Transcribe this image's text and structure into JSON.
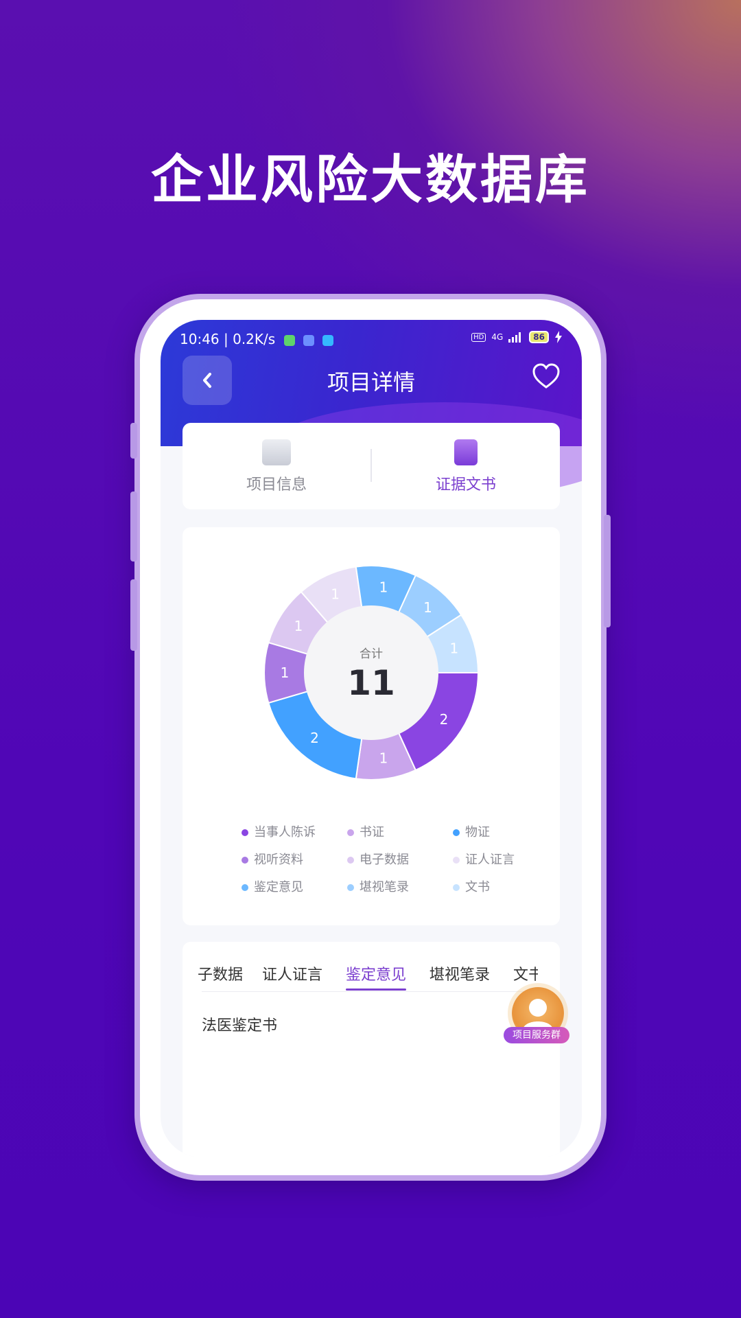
{
  "headline": "企业风险大数据库",
  "status_bar": {
    "time_speed": "10:46 | 0.2K/s",
    "hd": "HD",
    "network": "4G",
    "battery": "86"
  },
  "header": {
    "title": "项目详情",
    "back_icon": "chevron-left-icon",
    "favorite_icon": "heart-outline-icon"
  },
  "top_tabs": [
    {
      "label": "项目信息",
      "icon": "folder-icon",
      "active": false
    },
    {
      "label": "证据文书",
      "icon": "document-icon",
      "active": true
    }
  ],
  "chart_data": {
    "type": "pie",
    "title": "",
    "center_label": "合计",
    "total": "11",
    "slices": [
      {
        "name": "当事人陈诉",
        "value": 2,
        "color": "#8a45e2"
      },
      {
        "name": "书证",
        "value": 1,
        "color": "#c9a5ec"
      },
      {
        "name": "物证",
        "value": 2,
        "color": "#42a1ff"
      },
      {
        "name": "视听资料",
        "value": 1,
        "color": "#a87ae3"
      },
      {
        "name": "电子数据",
        "value": 1,
        "color": "#dcc8f1"
      },
      {
        "name": "证人证言",
        "value": 1,
        "color": "#e9e0f6"
      },
      {
        "name": "鉴定意见",
        "value": 1,
        "color": "#6cb8ff"
      },
      {
        "name": "堪视笔录",
        "value": 1,
        "color": "#9cceff"
      },
      {
        "name": "文书",
        "value": 1,
        "color": "#c7e3ff"
      }
    ],
    "legend_placement": "bottom"
  },
  "type_tabs": {
    "items": [
      "子数据",
      "证人证言",
      "鉴定意见",
      "堪视笔录",
      "文书"
    ],
    "active_index": 2
  },
  "documents": [
    "法医鉴定书"
  ],
  "service_button": {
    "label": "项目服务群",
    "icon": "customer-service-icon"
  }
}
